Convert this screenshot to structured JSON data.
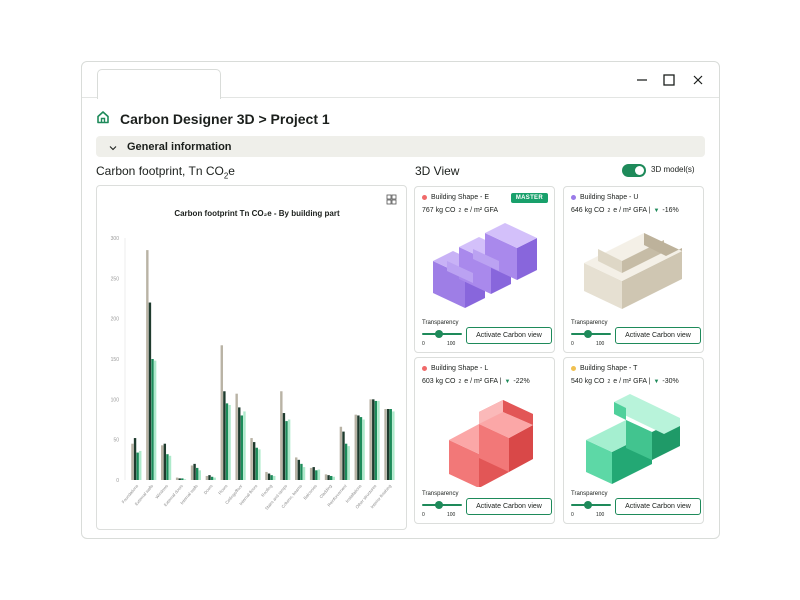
{
  "window": {
    "tab_label": "",
    "controls": {
      "minimize_icon": "minimize-icon",
      "maximize_icon": "maximize-icon",
      "close_icon": "close-icon"
    }
  },
  "header": {
    "home_icon": "home-icon",
    "title": "Carbon Designer 3D > Project 1"
  },
  "section": {
    "title": "General information",
    "icon": "chevron-down-icon"
  },
  "carbon": {
    "title_prefix": "Carbon footprint, Tn CO",
    "title_sub": "2",
    "title_suffix": "e"
  },
  "chart_data": {
    "type": "bar",
    "title": "Carbon footprint Tn CO₂e - By building part",
    "ylim": [
      0,
      300
    ],
    "yticks": [
      0,
      50,
      100,
      150,
      200,
      250,
      300
    ],
    "grid": false,
    "categories": [
      "Foundations",
      "External walls",
      "Windows",
      "External doors",
      "Internal walls",
      "Doors",
      "Floors",
      "Ceilings/floor",
      "Internal floors",
      "Roofing",
      "Stairs and ramps",
      "Column, beams",
      "Balconies",
      "Cladding",
      "Reinforcement",
      "Installations",
      "Other structures",
      "Interior finishing"
    ],
    "series": [
      {
        "name": "",
        "color": "#b9b3a5",
        "values": [
          45,
          285,
          43,
          3,
          18,
          5,
          167,
          107,
          52,
          10,
          110,
          28,
          15,
          7,
          66,
          81,
          100,
          88
        ]
      },
      {
        "name": "",
        "color": "#1f3b2e",
        "values": [
          52,
          220,
          45,
          2,
          20,
          6,
          110,
          90,
          47,
          8,
          83,
          25,
          16,
          6,
          60,
          80,
          100,
          88
        ]
      },
      {
        "name": "",
        "color": "#1c8c5a",
        "values": [
          34,
          150,
          32,
          2,
          15,
          4,
          95,
          80,
          40,
          6,
          73,
          20,
          12,
          5,
          45,
          78,
          98,
          88
        ]
      },
      {
        "name": "",
        "color": "#aeeacb",
        "values": [
          36,
          148,
          30,
          1,
          12,
          3,
          93,
          85,
          38,
          5,
          75,
          16,
          13,
          4,
          42,
          75,
          98,
          85
        ]
      }
    ]
  },
  "view3d": {
    "title": "3D View",
    "toggle_label": "3D model(s)",
    "toggle_on": true
  },
  "cards": [
    {
      "name": "Building Shape - E",
      "dot_color": "#f06a6a",
      "badge": "MASTER",
      "metric_prefix": "767 kg CO",
      "metric_sub": "2",
      "metric_suffix": "e / m² GFA",
      "delta": "",
      "shape": "E",
      "transparency_label": "Transparency",
      "min": "0",
      "max": "100",
      "button": "Activate Carbon view"
    },
    {
      "name": "Building Shape - U",
      "dot_color": "#9a7be8",
      "badge": "",
      "metric_prefix": "646 kg CO",
      "metric_sub": "2",
      "metric_suffix": "e / m² GFA |",
      "delta": "-16%",
      "shape": "U",
      "transparency_label": "Transparency",
      "min": "0",
      "max": "100",
      "button": "Activate Carbon view"
    },
    {
      "name": "Building Shape - L",
      "dot_color": "#f06a6a",
      "badge": "",
      "metric_prefix": "603 kg CO",
      "metric_sub": "2",
      "metric_suffix": "e / m² GFA |",
      "delta": "-22%",
      "shape": "L",
      "transparency_label": "Transparency",
      "min": "0",
      "max": "100",
      "button": "Activate Carbon view"
    },
    {
      "name": "Building Shape - T",
      "dot_color": "#f0c050",
      "badge": "",
      "metric_prefix": "540 kg CO",
      "metric_sub": "2",
      "metric_suffix": "e / m² GFA |",
      "delta": "-30%",
      "shape": "T",
      "transparency_label": "Transparency",
      "min": "0",
      "max": "100",
      "button": "Activate Carbon view"
    }
  ]
}
